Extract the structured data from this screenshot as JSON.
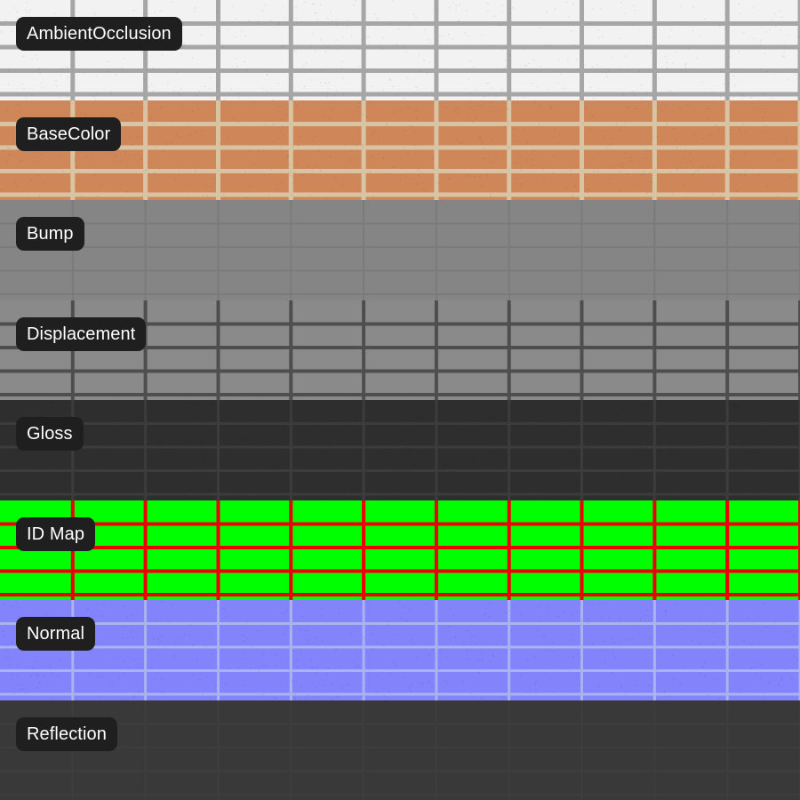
{
  "maps": [
    {
      "label": "AmbientOcclusion",
      "brick": "#f2f2f2",
      "mortar": "#a6a6a6",
      "mortar_width": 5,
      "noise": true
    },
    {
      "label": "BaseColor",
      "brick": "#cf875a",
      "mortar": "#d8c3a2",
      "mortar_width": 5,
      "noise": true
    },
    {
      "label": "Bump",
      "brick": "#858585",
      "mortar": "#7b7b7b",
      "mortar_width": 2,
      "noise": false
    },
    {
      "label": "Displacement",
      "brick": "#8a8a8a",
      "mortar": "#4e4e4e",
      "mortar_width": 4,
      "noise": false
    },
    {
      "label": "Gloss",
      "brick": "#2e2e2e",
      "mortar": "#3c3c3c",
      "mortar_width": 3,
      "noise": true
    },
    {
      "label": "ID Map",
      "brick": "#00ff00",
      "mortar": "#ee0000",
      "mortar_width": 4,
      "noise": false
    },
    {
      "label": "Normal",
      "brick": "#8383fb",
      "mortar": "#a9b4ef",
      "mortar_width": 3,
      "noise": true
    },
    {
      "label": "Reflection",
      "brick": "#393939",
      "mortar": "#3e3e3e",
      "mortar_width": 2,
      "noise": false
    }
  ]
}
